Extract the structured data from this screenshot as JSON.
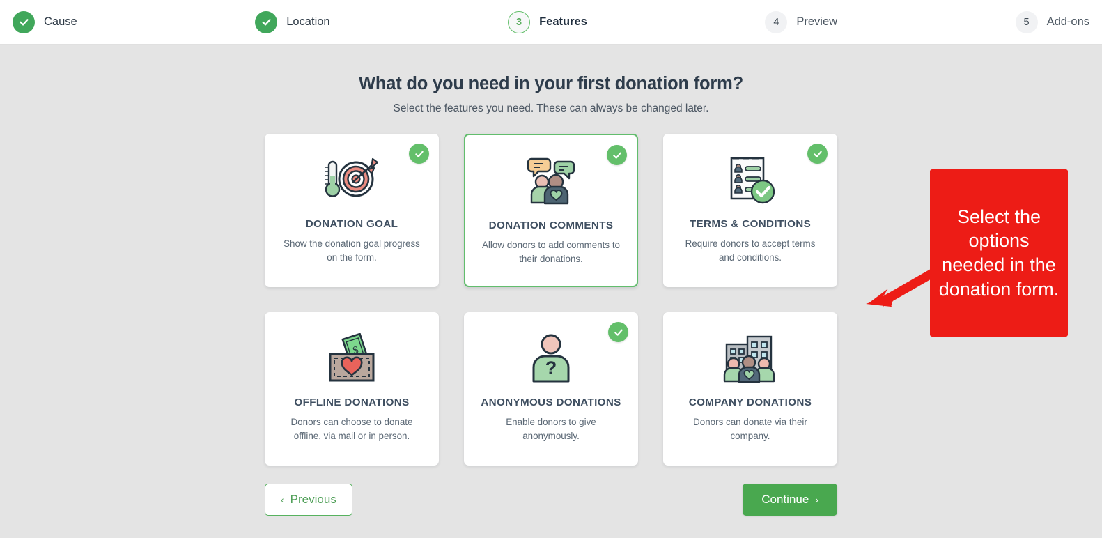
{
  "stepper": {
    "steps": [
      {
        "num": "1",
        "label": "Cause",
        "state": "done"
      },
      {
        "num": "2",
        "label": "Location",
        "state": "done"
      },
      {
        "num": "3",
        "label": "Features",
        "state": "current"
      },
      {
        "num": "4",
        "label": "Preview",
        "state": "todo"
      },
      {
        "num": "5",
        "label": "Add-ons",
        "state": "todo"
      }
    ]
  },
  "main": {
    "title": "What do you need in your first donation form?",
    "subtitle": "Select the features you need. These can always be changed later.",
    "cards": [
      {
        "icon": "target-goal-icon",
        "title": "DONATION GOAL",
        "desc": "Show the donation goal progress on the form.",
        "selected": true,
        "outlined": false
      },
      {
        "icon": "people-speech-bubbles-icon",
        "title": "DONATION COMMENTS",
        "desc": "Allow donors to add comments to their donations.",
        "selected": true,
        "outlined": true
      },
      {
        "icon": "checklist-document-icon",
        "title": "TERMS & CONDITIONS",
        "desc": "Require donors to accept terms and conditions.",
        "selected": true,
        "outlined": false
      },
      {
        "icon": "donation-box-cash-icon",
        "title": "OFFLINE DONATIONS",
        "desc": "Donors can choose to donate offline, via mail or in person.",
        "selected": false,
        "outlined": false
      },
      {
        "icon": "anonymous-person-icon",
        "title": "ANONYMOUS DONATIONS",
        "desc": "Enable donors to give anonymously.",
        "selected": true,
        "outlined": false
      },
      {
        "icon": "company-buildings-people-icon",
        "title": "COMPANY DONATIONS",
        "desc": "Donors can donate via their company.",
        "selected": false,
        "outlined": false
      }
    ]
  },
  "buttons": {
    "previous": "Previous",
    "previous_chevron": "‹",
    "continue": "Continue",
    "continue_chevron": "›"
  },
  "annotation": {
    "text": "Select the options needed in the donation form.",
    "color": "#ed1c16",
    "arrow": "arrow-pointing-down-left"
  },
  "colors": {
    "accent_green": "#49a84f",
    "badge_green": "#63bf6a",
    "step_done_green": "#41a75b",
    "page_background": "#e4e4e4",
    "card_background": "#ffffff",
    "annotation_red": "#ed1c16"
  }
}
